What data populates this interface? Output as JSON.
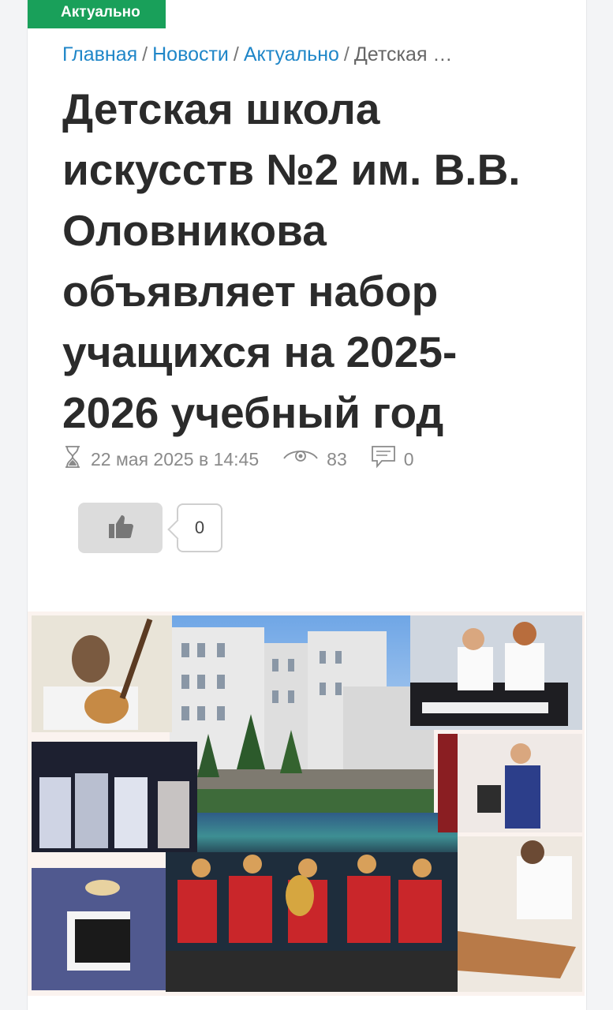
{
  "category_tag": "Актуально",
  "breadcrumb": {
    "items": [
      "Главная",
      "Новости",
      "Актуально"
    ],
    "current": "Детская …",
    "separator": "/"
  },
  "article": {
    "title": "Детская школа искусств №2 им. В.В. Оловникова объявляет набор учащихся на 2025-2026 учебный год",
    "date": "22 мая 2025 в 14:45",
    "views": "83",
    "comments": "0",
    "likes": "0"
  },
  "icons": [
    "hourglass-icon",
    "eye-icon",
    "comment-icon",
    "thumbs-up-icon"
  ],
  "colors": {
    "accent_green": "#19a05a",
    "link_blue": "#1f86c8",
    "title": "#2b2b2b",
    "meta_gray": "#8a8a8a"
  }
}
